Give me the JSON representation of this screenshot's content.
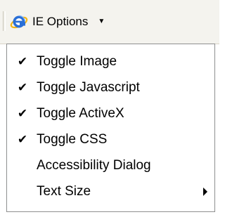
{
  "toolbar": {
    "button_label": "IE Options",
    "button_icon": "internet-explorer-icon",
    "dropdown_indicator": "▼"
  },
  "menu": {
    "items": [
      {
        "label": "Toggle Image",
        "checked": true,
        "check_glyph": "✔"
      },
      {
        "label": "Toggle Javascript",
        "checked": true,
        "check_glyph": "✔"
      },
      {
        "label": "Toggle ActiveX",
        "checked": true,
        "check_glyph": "✔"
      },
      {
        "label": "Toggle CSS",
        "checked": true,
        "check_glyph": "✔"
      },
      {
        "label": "Accessibility Dialog",
        "checked": false,
        "check_glyph": ""
      },
      {
        "label": "Text Size",
        "checked": false,
        "check_glyph": "",
        "has_submenu": true
      }
    ]
  },
  "colors": {
    "ie_blue": "#2a6fd6",
    "ie_gold": "#f2b619",
    "menu_border": "#8e8f8f",
    "toolbar_bg": "#f4f3ee"
  }
}
